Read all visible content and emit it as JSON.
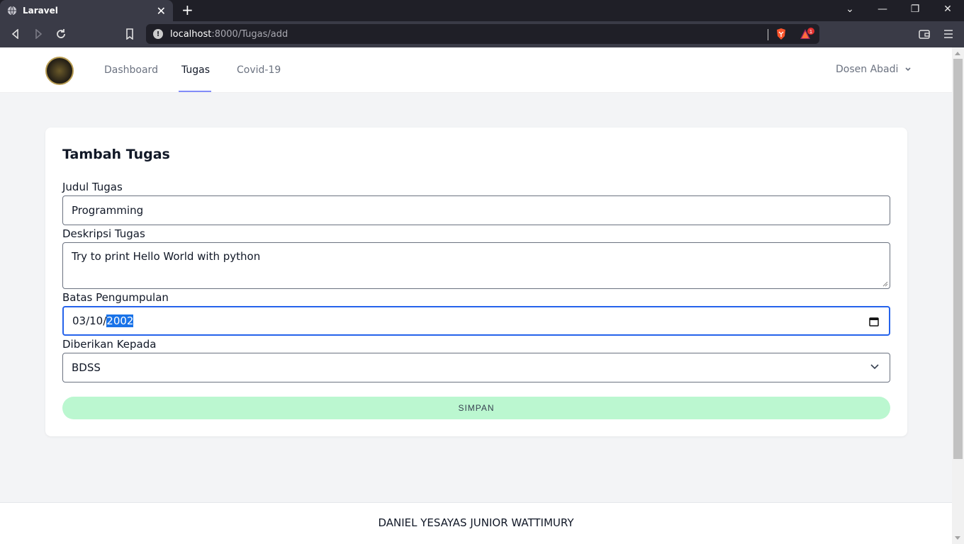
{
  "browser": {
    "tab_title": "Laravel",
    "url_host": "localhost",
    "url_rest": ":8000/Tugas/add",
    "notification_count": "1"
  },
  "nav": {
    "links": [
      "Dashboard",
      "Tugas",
      "Covid-19"
    ],
    "active": "Tugas",
    "user": "Dosen Abadi"
  },
  "form": {
    "title": "Tambah Tugas",
    "judul_label": "Judul Tugas",
    "judul_value": "Programming",
    "deskripsi_label": "Deskripsi Tugas",
    "deskripsi_value": "Try to print Hello World with python",
    "batas_label": "Batas Pengumpulan",
    "batas_prefix": "03/10/",
    "batas_year": "2002",
    "diberikan_label": "Diberikan Kepada",
    "diberikan_value": "BDSS",
    "submit_label": "SIMPAN"
  },
  "footer": {
    "text": "DANIEL YESAYAS JUNIOR WATTIMURY"
  },
  "colors": {
    "accent": "#818cf8",
    "button": "#bbf7d0",
    "focus": "#2563eb"
  }
}
